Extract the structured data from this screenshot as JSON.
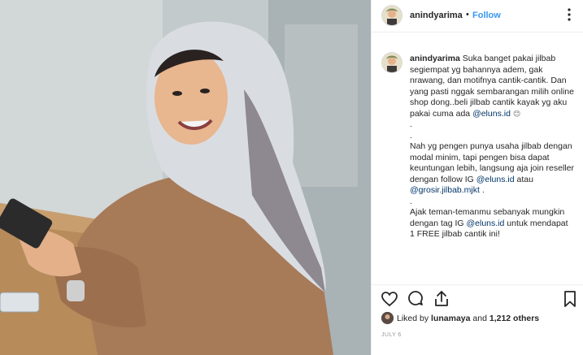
{
  "post": {
    "author": {
      "username": "anindyarima",
      "separator": "•",
      "follow_label": "Follow",
      "more_icon": "ellipsis-vertical-icon"
    },
    "caption": {
      "username": "anindyarima",
      "p1": " Suka banget pakai jilbab segiempat yg bahannya adem, gak nrawang, dan motifnya cantik-cantik. Dan yang pasti nggak sembarangan milih online shop dong..beli jilbab cantik kayak yg aku pakai cuma ada ",
      "mention1": "@eluns.id",
      "emoji": "😊",
      "dot1": ".",
      "dot2": ".",
      "p2": "Nah yg pengen punya usaha jilbab dengan modal minim, tapi pengen bisa dapat keuntungan lebih, langsung aja join reseller dengan follow IG ",
      "mention2": "@eluns.id",
      "p2b": " atau ",
      "mention3": "@grosir.jilbab.mjkt",
      "p2c": " .",
      "dot3": ".",
      "p3": "Ajak teman-temanmu sebanyak mungkin dengan tag IG ",
      "mention4": "@eluns.id",
      "p3b": " untuk mendapat 1 FREE jilbab cantik ini!"
    },
    "actions": {
      "like_icon": "heart-icon",
      "comment_icon": "comment-bubble-icon",
      "share_icon": "share-icon",
      "save_icon": "bookmark-icon"
    },
    "likes": {
      "prefix": "Liked by",
      "user": "lunamaya",
      "and": "and",
      "others": "1,212 others"
    },
    "date": "JULY 6"
  }
}
